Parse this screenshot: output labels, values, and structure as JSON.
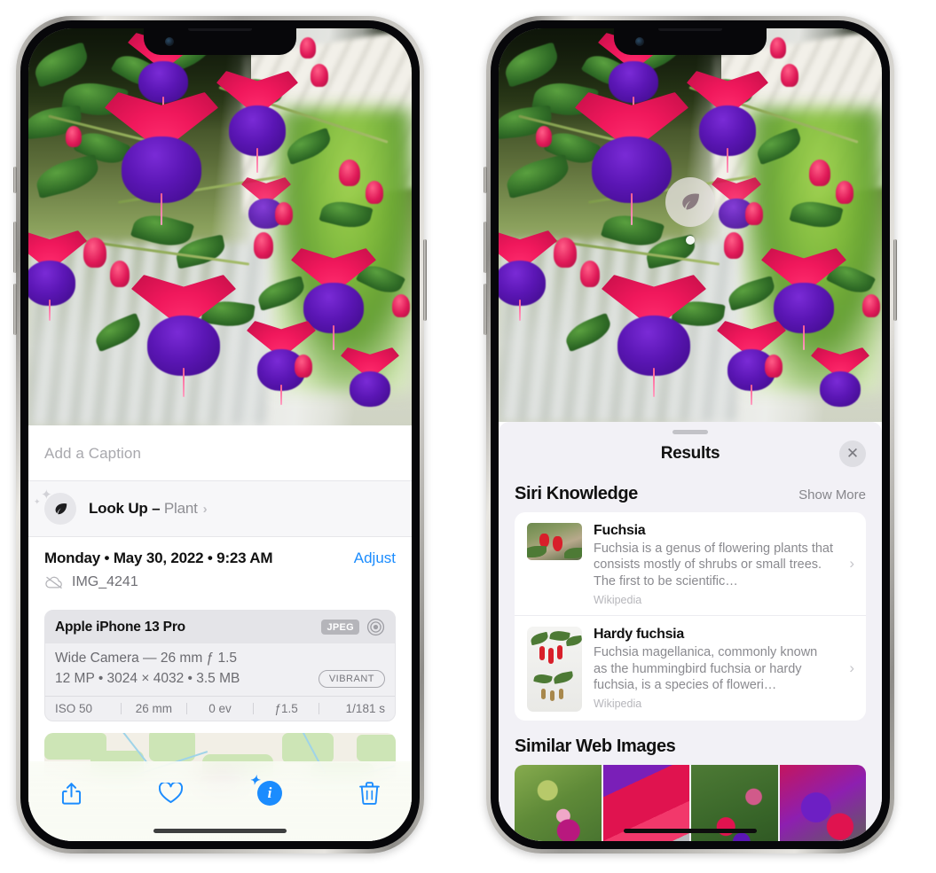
{
  "left_phone": {
    "name": "iPhone showing Photos app info panel",
    "caption_placeholder": "Add a Caption",
    "lookup": {
      "label": "Look Up – ",
      "subject": "Plant",
      "icon": "leaf-icon",
      "chevron": "›"
    },
    "metadata": {
      "date": "Monday • May 30, 2022 • 9:23 AM",
      "adjust_label": "Adjust",
      "filename": "IMG_4241",
      "cloud_icon": "cloud-slash-icon"
    },
    "camera_card": {
      "model": "Apple iPhone 13 Pro",
      "format_badge": "JPEG",
      "lens_icon": "aperture-icon",
      "lens": "Wide Camera — 26 mm ƒ 1.5",
      "specs": "12 MP • 3024 × 4032 • 3.5 MB",
      "style_badge": "VIBRANT",
      "exif": [
        "ISO 50",
        "26 mm",
        "0 ev",
        "ƒ1.5",
        "1/181 s"
      ]
    },
    "toolbar": {
      "share_label": "share-icon",
      "favorite_label": "heart-icon",
      "info_label": "info-sparkle-icon",
      "delete_label": "trash-icon"
    }
  },
  "right_phone": {
    "name": "iPhone showing Visual Look Up results",
    "vlu_badge_icon": "leaf-icon",
    "sheet": {
      "title": "Results",
      "close_label": "✕"
    },
    "siri_knowledge": {
      "title": "Siri Knowledge",
      "action": "Show More",
      "items": [
        {
          "title": "Fuchsia",
          "description": "Fuchsia is a genus of flowering plants that consists mostly of shrubs or small trees. The first to be scientific…",
          "source": "Wikipedia",
          "chevron": "›"
        },
        {
          "title": "Hardy fuchsia",
          "description": "Fuchsia magellanica, commonly known as the hummingbird fuchsia or hardy fuchsia, is a species of floweri…",
          "source": "Wikipedia",
          "chevron": "›"
        }
      ]
    },
    "similar_web_images": {
      "title": "Similar Web Images",
      "count": 4
    }
  },
  "colors": {
    "accent_blue": "#1b8cfe",
    "sheet_bg": "#f2f1f6",
    "card_bg": "#ffffff",
    "secondary_text": "#8a8a8f",
    "badge_gray": "#b5b5ba"
  }
}
